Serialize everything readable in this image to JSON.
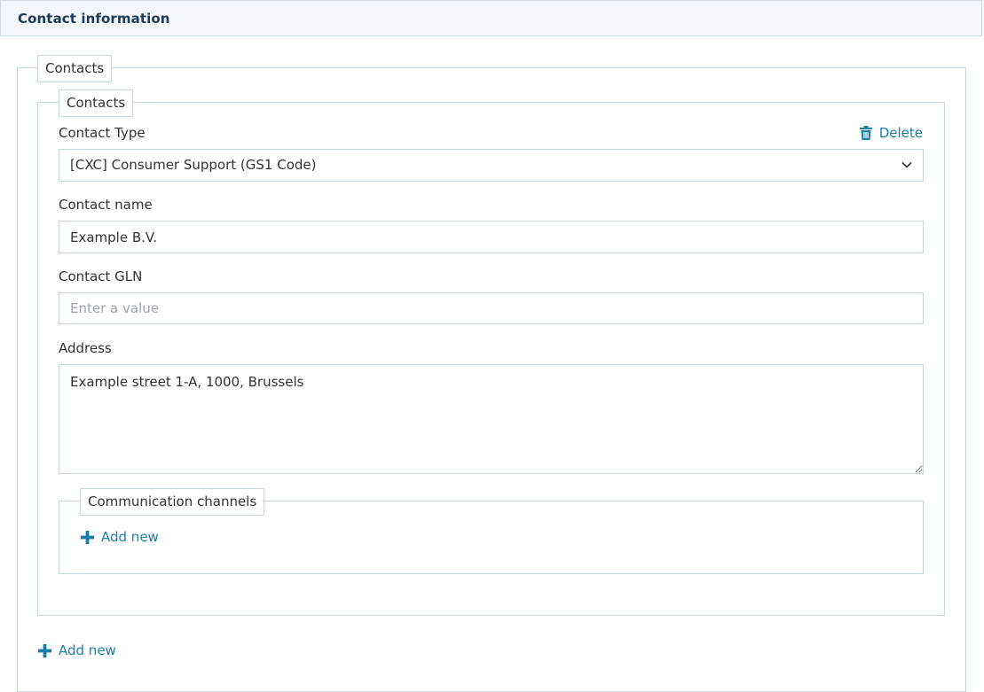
{
  "section": {
    "title": "Contact information"
  },
  "outer_group": {
    "legend": "Contacts",
    "add_new_label": "Add new"
  },
  "contact": {
    "legend": "Contacts",
    "delete_label": "Delete",
    "contact_type": {
      "label": "Contact Type",
      "value": "[CXC] Consumer Support (GS1 Code)"
    },
    "contact_name": {
      "label": "Contact name",
      "value": "Example B.V."
    },
    "contact_gln": {
      "label": "Contact GLN",
      "value": "",
      "placeholder": "Enter a value"
    },
    "address": {
      "label": "Address",
      "value": "Example street 1-A, 1000, Brussels"
    },
    "communication_channels": {
      "legend": "Communication channels",
      "add_new_label": "Add new"
    }
  },
  "colors": {
    "accent": "#1a7fa6",
    "border": "#c8d6e3",
    "header_bg": "#f2f6fa",
    "header_text": "#1f3b57"
  },
  "icons": {
    "delete": "trash-icon",
    "add": "plus-icon",
    "select": "chevron-down-icon"
  }
}
